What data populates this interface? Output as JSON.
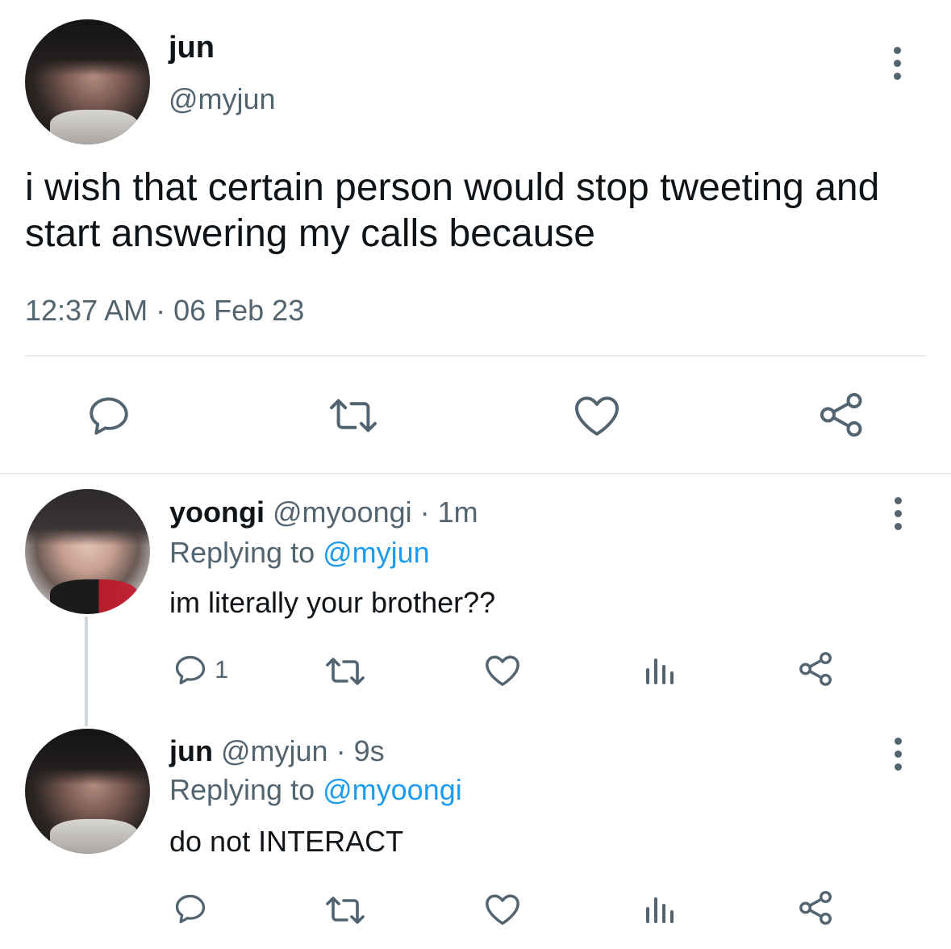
{
  "main_tweet": {
    "name": "jun",
    "handle": "@myjun",
    "text_line1": "i wish that certain person would stop tweeting and",
    "text_line2": "start answering my calls because",
    "timestamp": "12:37 AM · 06 Feb 23"
  },
  "replies": [
    {
      "name": "yoongi",
      "handle": "@myoongi",
      "time": "· 1m",
      "replying_prefix": "Replying to",
      "replying_to": "@myjun",
      "text": "im literally your brother??",
      "reply_count": "1"
    },
    {
      "name": "jun",
      "handle": "@myjun",
      "time": "· 9s",
      "replying_prefix": "Replying to",
      "replying_to": "@myoongi",
      "text": "do not INTERACT",
      "reply_count": ""
    }
  ],
  "icons": {
    "reply": "reply-icon",
    "retweet": "retweet-icon",
    "like": "heart-icon",
    "share": "share-icon",
    "analytics": "analytics-icon",
    "more": "more-options-icon"
  },
  "colors": {
    "text": "#0f1419",
    "secondary": "#536471",
    "link": "#1d9bf0",
    "divider": "#e6ecf0"
  }
}
